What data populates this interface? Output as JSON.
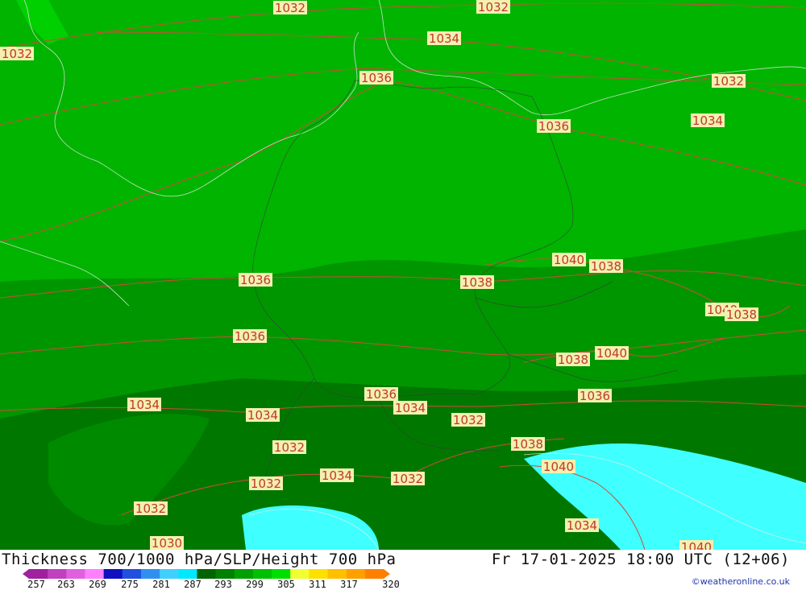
{
  "title": "Thickness 700/1000 hPa/SLP/Height 700 hPa",
  "valid_time": "Fr 17-01-2025 18:00 UTC (12+06)",
  "credit": "©weatheronline.co.uk",
  "legend": {
    "ticks": [
      "257",
      "263",
      "269",
      "275",
      "281",
      "287",
      "293",
      "299",
      "305",
      "311",
      "317",
      "320"
    ],
    "colors": [
      "#a020a0",
      "#c040c0",
      "#e060e0",
      "#ff80ff",
      "#1010c0",
      "#2050e0",
      "#3090f0",
      "#40d0ff",
      "#00e8ff",
      "#006400",
      "#008000",
      "#00a000",
      "#00c000",
      "#00e000",
      "#f0ff30",
      "#ffe000",
      "#ffc000",
      "#ffa000",
      "#ff8000"
    ]
  },
  "fill_colors": {
    "light_green": "#00b400",
    "mid_green": "#009600",
    "dark_green": "#007800",
    "cyan": "#40ffff",
    "lighter_green": "#00c800"
  },
  "isobar_labels": [
    "1032",
    "1032",
    "1034",
    "1032",
    "1036",
    "1032",
    "1036",
    "1034",
    "1040",
    "1038",
    "1036",
    "1038",
    "1040",
    "1038",
    "1036",
    "1038",
    "1040",
    "1034",
    "1036",
    "1034",
    "1034",
    "1032",
    "1036",
    "1032",
    "1038",
    "1040",
    "1032",
    "1034",
    "1032",
    "1032",
    "1034",
    "1030",
    "1040"
  ]
}
